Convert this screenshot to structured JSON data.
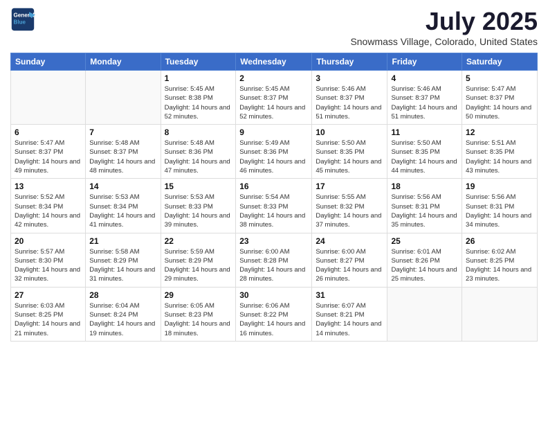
{
  "header": {
    "logo_line1": "General",
    "logo_line2": "Blue",
    "main_title": "July 2025",
    "subtitle": "Snowmass Village, Colorado, United States"
  },
  "days_of_week": [
    "Sunday",
    "Monday",
    "Tuesday",
    "Wednesday",
    "Thursday",
    "Friday",
    "Saturday"
  ],
  "weeks": [
    [
      {
        "day": "",
        "sunrise": "",
        "sunset": "",
        "daylight": ""
      },
      {
        "day": "",
        "sunrise": "",
        "sunset": "",
        "daylight": ""
      },
      {
        "day": "1",
        "sunrise": "Sunrise: 5:45 AM",
        "sunset": "Sunset: 8:38 PM",
        "daylight": "Daylight: 14 hours and 52 minutes."
      },
      {
        "day": "2",
        "sunrise": "Sunrise: 5:45 AM",
        "sunset": "Sunset: 8:37 PM",
        "daylight": "Daylight: 14 hours and 52 minutes."
      },
      {
        "day": "3",
        "sunrise": "Sunrise: 5:46 AM",
        "sunset": "Sunset: 8:37 PM",
        "daylight": "Daylight: 14 hours and 51 minutes."
      },
      {
        "day": "4",
        "sunrise": "Sunrise: 5:46 AM",
        "sunset": "Sunset: 8:37 PM",
        "daylight": "Daylight: 14 hours and 51 minutes."
      },
      {
        "day": "5",
        "sunrise": "Sunrise: 5:47 AM",
        "sunset": "Sunset: 8:37 PM",
        "daylight": "Daylight: 14 hours and 50 minutes."
      }
    ],
    [
      {
        "day": "6",
        "sunrise": "Sunrise: 5:47 AM",
        "sunset": "Sunset: 8:37 PM",
        "daylight": "Daylight: 14 hours and 49 minutes."
      },
      {
        "day": "7",
        "sunrise": "Sunrise: 5:48 AM",
        "sunset": "Sunset: 8:37 PM",
        "daylight": "Daylight: 14 hours and 48 minutes."
      },
      {
        "day": "8",
        "sunrise": "Sunrise: 5:48 AM",
        "sunset": "Sunset: 8:36 PM",
        "daylight": "Daylight: 14 hours and 47 minutes."
      },
      {
        "day": "9",
        "sunrise": "Sunrise: 5:49 AM",
        "sunset": "Sunset: 8:36 PM",
        "daylight": "Daylight: 14 hours and 46 minutes."
      },
      {
        "day": "10",
        "sunrise": "Sunrise: 5:50 AM",
        "sunset": "Sunset: 8:35 PM",
        "daylight": "Daylight: 14 hours and 45 minutes."
      },
      {
        "day": "11",
        "sunrise": "Sunrise: 5:50 AM",
        "sunset": "Sunset: 8:35 PM",
        "daylight": "Daylight: 14 hours and 44 minutes."
      },
      {
        "day": "12",
        "sunrise": "Sunrise: 5:51 AM",
        "sunset": "Sunset: 8:35 PM",
        "daylight": "Daylight: 14 hours and 43 minutes."
      }
    ],
    [
      {
        "day": "13",
        "sunrise": "Sunrise: 5:52 AM",
        "sunset": "Sunset: 8:34 PM",
        "daylight": "Daylight: 14 hours and 42 minutes."
      },
      {
        "day": "14",
        "sunrise": "Sunrise: 5:53 AM",
        "sunset": "Sunset: 8:34 PM",
        "daylight": "Daylight: 14 hours and 41 minutes."
      },
      {
        "day": "15",
        "sunrise": "Sunrise: 5:53 AM",
        "sunset": "Sunset: 8:33 PM",
        "daylight": "Daylight: 14 hours and 39 minutes."
      },
      {
        "day": "16",
        "sunrise": "Sunrise: 5:54 AM",
        "sunset": "Sunset: 8:33 PM",
        "daylight": "Daylight: 14 hours and 38 minutes."
      },
      {
        "day": "17",
        "sunrise": "Sunrise: 5:55 AM",
        "sunset": "Sunset: 8:32 PM",
        "daylight": "Daylight: 14 hours and 37 minutes."
      },
      {
        "day": "18",
        "sunrise": "Sunrise: 5:56 AM",
        "sunset": "Sunset: 8:31 PM",
        "daylight": "Daylight: 14 hours and 35 minutes."
      },
      {
        "day": "19",
        "sunrise": "Sunrise: 5:56 AM",
        "sunset": "Sunset: 8:31 PM",
        "daylight": "Daylight: 14 hours and 34 minutes."
      }
    ],
    [
      {
        "day": "20",
        "sunrise": "Sunrise: 5:57 AM",
        "sunset": "Sunset: 8:30 PM",
        "daylight": "Daylight: 14 hours and 32 minutes."
      },
      {
        "day": "21",
        "sunrise": "Sunrise: 5:58 AM",
        "sunset": "Sunset: 8:29 PM",
        "daylight": "Daylight: 14 hours and 31 minutes."
      },
      {
        "day": "22",
        "sunrise": "Sunrise: 5:59 AM",
        "sunset": "Sunset: 8:29 PM",
        "daylight": "Daylight: 14 hours and 29 minutes."
      },
      {
        "day": "23",
        "sunrise": "Sunrise: 6:00 AM",
        "sunset": "Sunset: 8:28 PM",
        "daylight": "Daylight: 14 hours and 28 minutes."
      },
      {
        "day": "24",
        "sunrise": "Sunrise: 6:00 AM",
        "sunset": "Sunset: 8:27 PM",
        "daylight": "Daylight: 14 hours and 26 minutes."
      },
      {
        "day": "25",
        "sunrise": "Sunrise: 6:01 AM",
        "sunset": "Sunset: 8:26 PM",
        "daylight": "Daylight: 14 hours and 25 minutes."
      },
      {
        "day": "26",
        "sunrise": "Sunrise: 6:02 AM",
        "sunset": "Sunset: 8:25 PM",
        "daylight": "Daylight: 14 hours and 23 minutes."
      }
    ],
    [
      {
        "day": "27",
        "sunrise": "Sunrise: 6:03 AM",
        "sunset": "Sunset: 8:25 PM",
        "daylight": "Daylight: 14 hours and 21 minutes."
      },
      {
        "day": "28",
        "sunrise": "Sunrise: 6:04 AM",
        "sunset": "Sunset: 8:24 PM",
        "daylight": "Daylight: 14 hours and 19 minutes."
      },
      {
        "day": "29",
        "sunrise": "Sunrise: 6:05 AM",
        "sunset": "Sunset: 8:23 PM",
        "daylight": "Daylight: 14 hours and 18 minutes."
      },
      {
        "day": "30",
        "sunrise": "Sunrise: 6:06 AM",
        "sunset": "Sunset: 8:22 PM",
        "daylight": "Daylight: 14 hours and 16 minutes."
      },
      {
        "day": "31",
        "sunrise": "Sunrise: 6:07 AM",
        "sunset": "Sunset: 8:21 PM",
        "daylight": "Daylight: 14 hours and 14 minutes."
      },
      {
        "day": "",
        "sunrise": "",
        "sunset": "",
        "daylight": ""
      },
      {
        "day": "",
        "sunrise": "",
        "sunset": "",
        "daylight": ""
      }
    ]
  ]
}
